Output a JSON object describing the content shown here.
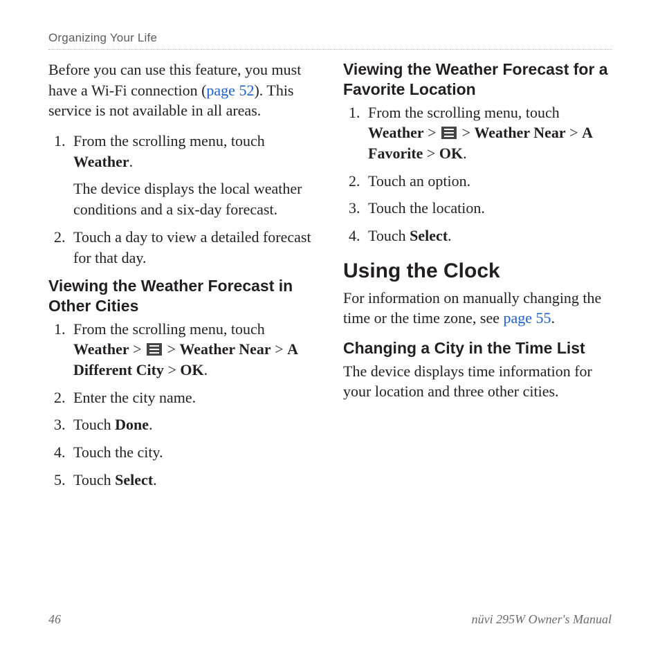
{
  "header": {
    "running_head": "Organizing Your Life"
  },
  "left": {
    "intro": {
      "pre": "Before you can use this feature, you must have a Wi-Fi connection (",
      "link": "page 52",
      "post": "). This service is not available in all areas."
    },
    "steps_a": {
      "s1_pre": "From the scrolling menu, touch ",
      "s1_bold": "Weather",
      "s1_post": ".",
      "s1_sub": "The device displays the local weather conditions and a six-day forecast.",
      "s2": "Touch a day to view a detailed forecast for that day."
    },
    "sub1_title": "Viewing the Weather Forecast in Other Cities",
    "steps_b": {
      "s1_pre": "From the scrolling menu, touch ",
      "s1_b1": "Weather",
      "gt": " > ",
      "s1_b2": "Weather Near",
      "s1_b3": "A Different City",
      "s1_b4": "OK",
      "s1_end": ".",
      "s2": "Enter the city name.",
      "s3_pre": "Touch ",
      "s3_bold": "Done",
      "s3_post": ".",
      "s4": "Touch the city.",
      "s5_pre": "Touch ",
      "s5_bold": "Select",
      "s5_post": "."
    }
  },
  "right": {
    "sub1_title": "Viewing the Weather Forecast for a Favorite Location",
    "steps_c": {
      "s1_pre": "From the scrolling menu, touch ",
      "s1_b1": "Weather",
      "gt": " > ",
      "s1_b2": "Weather Near",
      "s1_b3": "A Favorite",
      "s1_b4": "OK",
      "s1_end": ".",
      "s2": "Touch an option.",
      "s3": "Touch the location.",
      "s4_pre": "Touch ",
      "s4_bold": "Select",
      "s4_post": "."
    },
    "h2": "Using the Clock",
    "clock_intro_pre": "For information on manually changing the time or the time zone, see ",
    "clock_intro_link": "page 55",
    "clock_intro_post": ".",
    "sub2_title": "Changing a City in the Time List",
    "sub2_body": "The device displays time information for your location and three other cities."
  },
  "footer": {
    "page": "46",
    "manual": "nüvi 295W Owner's Manual"
  }
}
